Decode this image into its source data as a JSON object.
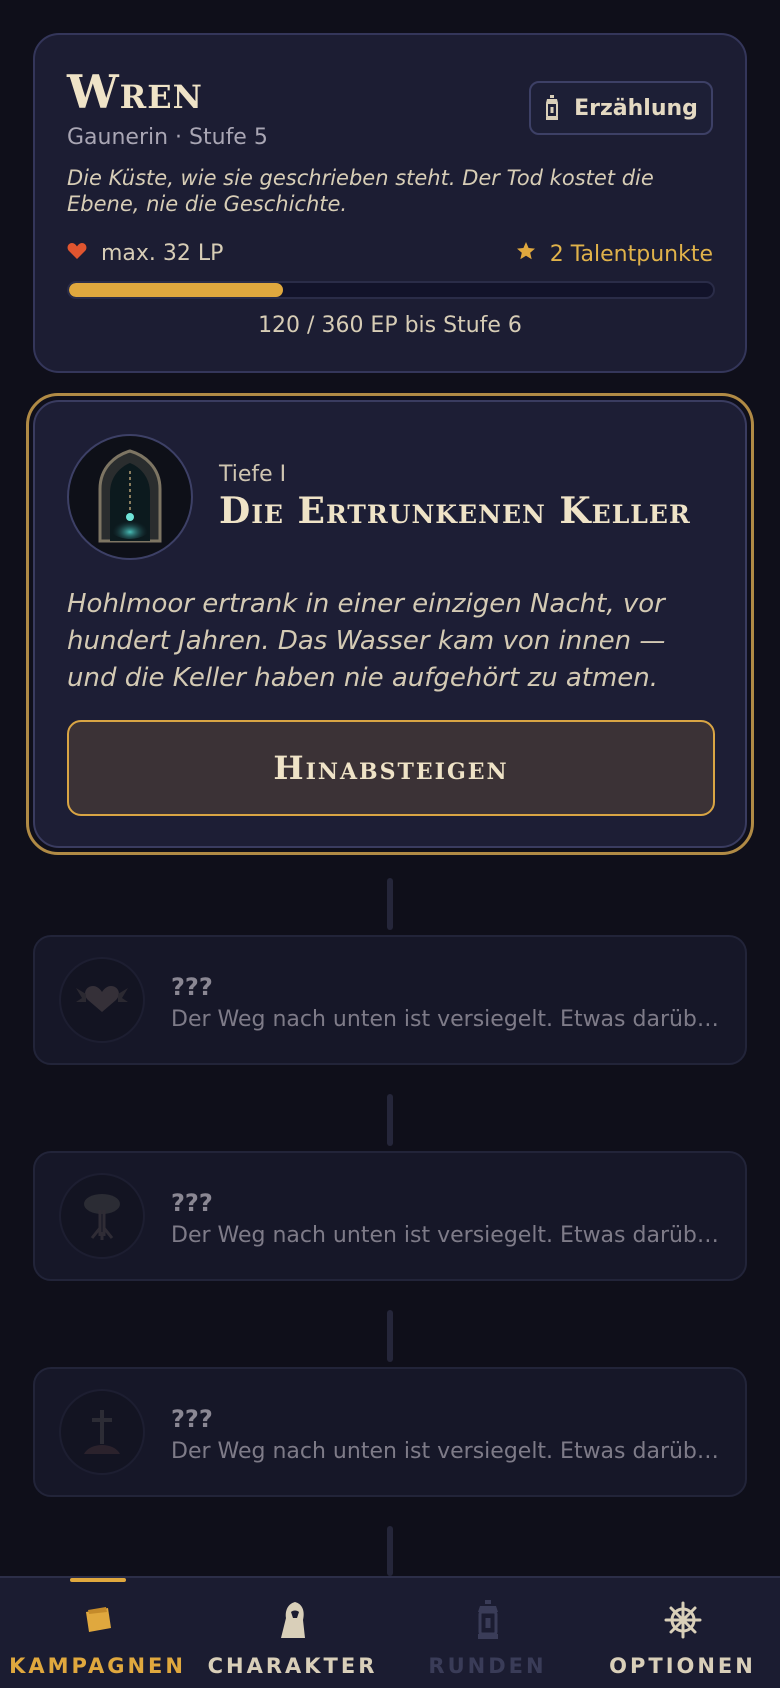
{
  "character": {
    "name": "Wren",
    "class_level": "Gaunerin · Stufe 5",
    "story_button": "Erzählung",
    "quote": "Die Küste, wie sie geschrieben steht. Der Tod kostet die Ebene, nie die Geschichte.",
    "hp": "max. 32 LP",
    "talent_points": "2 Talentpunkte",
    "xp_progress": 0.333,
    "xp_text": "120 / 360 EP bis Stufe 6"
  },
  "active_depth": {
    "tier": "Tiefe I",
    "title": "Die Ertrunkenen Keller",
    "description": "Hohlmoor ertrank in einer einzigen Nacht, vor hundert Jahren. Das Wasser kam von innen — und die Keller haben nie aufgehört zu atmen.",
    "button": "Hinabsteigen"
  },
  "locked_depths": [
    {
      "title": "???",
      "description": "Der Weg nach unten ist versiegelt. Etwas darüber muss zuerst fallen."
    },
    {
      "title": "???",
      "description": "Der Weg nach unten ist versiegelt. Etwas darüber muss zuerst fallen."
    },
    {
      "title": "???",
      "description": "Der Weg nach unten ist versiegelt. Etwas darüber muss zuerst fallen."
    }
  ],
  "nav": [
    {
      "label": "KAMPAGNEN",
      "icon": "cards-icon",
      "active": true,
      "color": "#e0a83e"
    },
    {
      "label": "CHARAKTER",
      "icon": "hooded-figure-icon",
      "active": false,
      "color": "#d9cfb9"
    },
    {
      "label": "RUNDEN",
      "icon": "lantern-icon",
      "active": false,
      "color": "#3a3c58"
    },
    {
      "label": "OPTIONEN",
      "icon": "ship-wheel-icon",
      "active": false,
      "color": "#d9cfb9"
    }
  ],
  "colors": {
    "accent": "#e0a83e",
    "heart": "#e0552f",
    "background": "#0f0f1a"
  }
}
